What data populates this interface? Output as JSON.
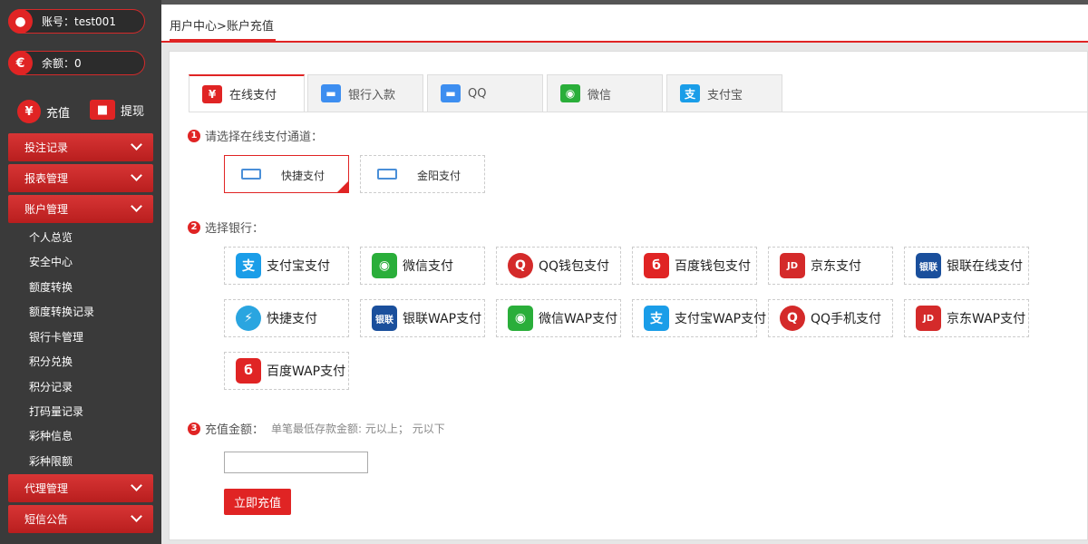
{
  "sidebar": {
    "account_label": "账号：test001",
    "balance_label": "余额：0",
    "quick_actions": [
      {
        "label": "充值",
        "icon": "yen-icon"
      },
      {
        "label": "提现",
        "icon": "wallet-icon"
      }
    ],
    "menus": [
      {
        "label": "投注记录"
      },
      {
        "label": "报表管理"
      },
      {
        "label": "账户管理"
      },
      {
        "label": "代理管理"
      },
      {
        "label": "短信公告"
      }
    ],
    "submenu": [
      "个人总览",
      "安全中心",
      "额度转换",
      "额度转换记录",
      "银行卡管理",
      "积分兑换",
      "积分记录",
      "打码量记录",
      "彩种信息",
      "彩种限额"
    ]
  },
  "breadcrumb": "用户中心>账户充值",
  "tabs": [
    {
      "label": "在线支付",
      "icon": "yen-icon",
      "color": "#e02424"
    },
    {
      "label": "银行入款",
      "icon": "bank-card-icon",
      "color": "#3d8ef0"
    },
    {
      "label": "QQ",
      "icon": "card-icon",
      "color": "#3d8ef0"
    },
    {
      "label": "微信",
      "icon": "wechat-icon",
      "color": "#2aae3a"
    },
    {
      "label": "支付宝",
      "icon": "alipay-icon",
      "color": "#1a9de8"
    }
  ],
  "steps": {
    "channel": "请选择在线支付通道：",
    "bank": "选择银行：",
    "amount": "充值金额：",
    "amount_hint": "单笔最低存款金额: 元以上； 元以下"
  },
  "channels": [
    "快捷支付",
    "金阳支付"
  ],
  "banks": [
    {
      "label": "支付宝支付",
      "icon": "alipay-icon",
      "glyph": "支",
      "color": "#1a9de8"
    },
    {
      "label": "微信支付",
      "icon": "wechat-icon",
      "glyph": "◉",
      "color": "#2aae3a"
    },
    {
      "label": "QQ钱包支付",
      "icon": "qq-icon",
      "glyph": "Q",
      "color": "#d42a2a"
    },
    {
      "label": "百度钱包支付",
      "icon": "baidu-wallet-icon",
      "glyph": "б",
      "color": "#e02424"
    },
    {
      "label": "京东支付",
      "icon": "jd-icon",
      "glyph": "JD",
      "color": "#d42a2a"
    },
    {
      "label": "银联在线支付",
      "icon": "unionpay-icon",
      "glyph": "银联",
      "color": "#1a4f9c"
    },
    {
      "label": "快捷支付",
      "icon": "lightning-icon",
      "glyph": "⚡",
      "color": "#2aa5e0"
    },
    {
      "label": "银联WAP支付",
      "icon": "unionpay-icon",
      "glyph": "银联",
      "color": "#1a4f9c"
    },
    {
      "label": "微信WAP支付",
      "icon": "wechat-icon",
      "glyph": "◉",
      "color": "#2aae3a"
    },
    {
      "label": "支付宝WAP支付",
      "icon": "alipay-icon",
      "glyph": "支",
      "color": "#1a9de8"
    },
    {
      "label": "QQ手机支付",
      "icon": "qq-icon",
      "glyph": "Q",
      "color": "#d42a2a"
    },
    {
      "label": "京东WAP支付",
      "icon": "jd-icon",
      "glyph": "JD",
      "color": "#d42a2a"
    },
    {
      "label": "百度WAP支付",
      "icon": "baidu-wallet-icon",
      "glyph": "б",
      "color": "#e02424"
    }
  ],
  "submit_label": "立即充值",
  "accent_color": "#e02424"
}
